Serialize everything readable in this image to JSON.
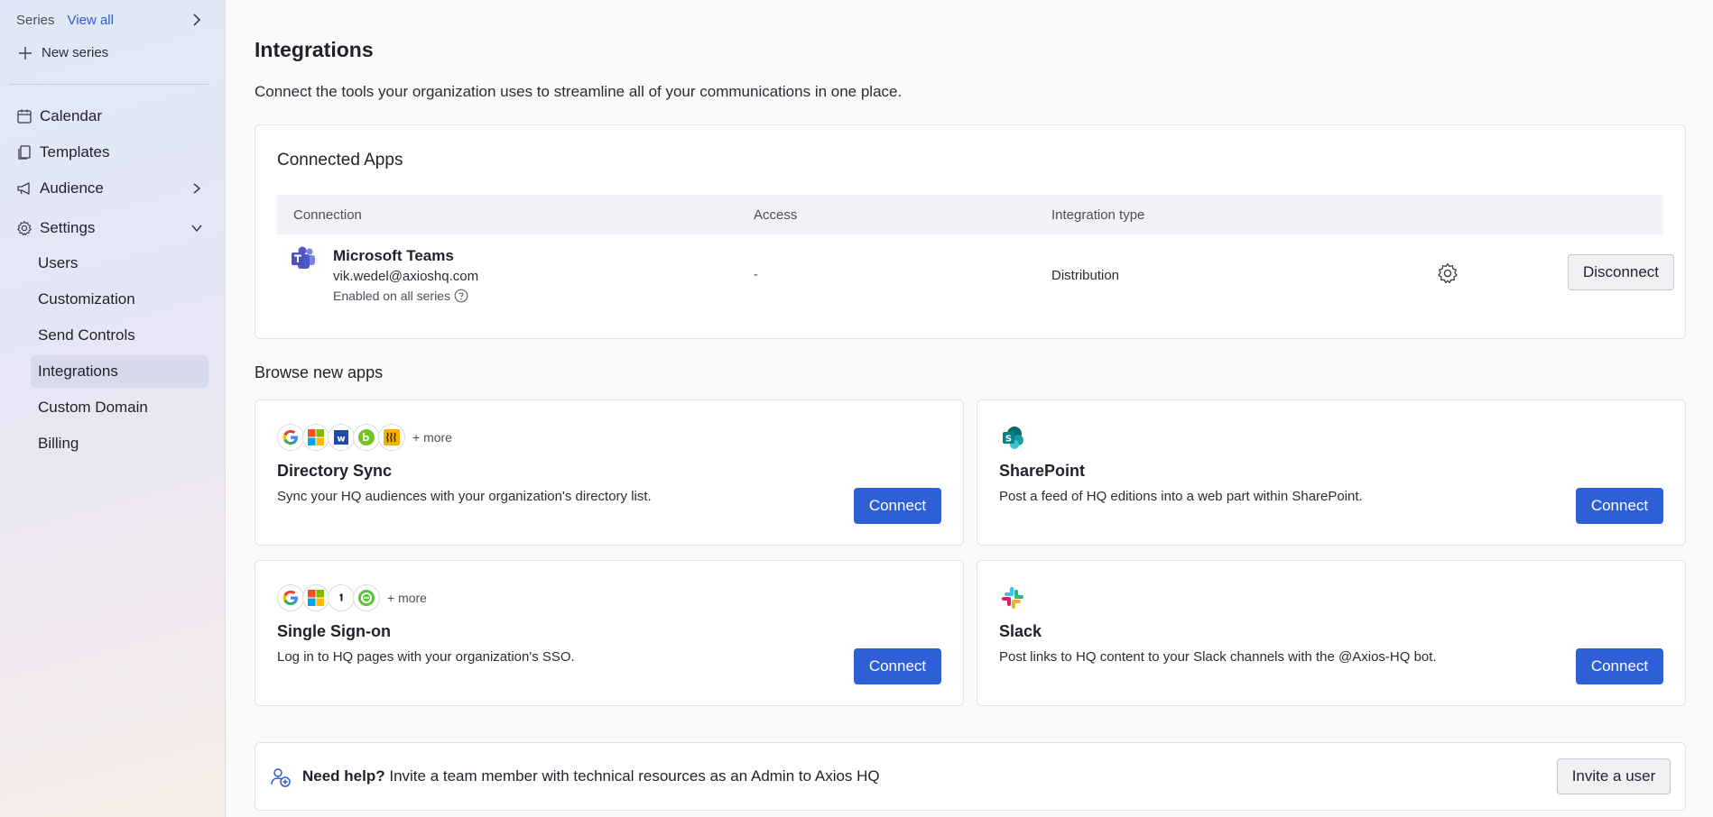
{
  "sidebar": {
    "series_label": "Series",
    "view_all": "View all",
    "new_series": "New series",
    "nav": {
      "calendar": "Calendar",
      "templates": "Templates",
      "audience": "Audience",
      "settings": "Settings"
    },
    "settings_items": {
      "users": "Users",
      "customization": "Customization",
      "send_controls": "Send Controls",
      "integrations": "Integrations",
      "custom_domain": "Custom Domain",
      "billing": "Billing"
    },
    "active_item": "Integrations"
  },
  "main": {
    "title": "Integrations",
    "subtitle": "Connect the tools your organization uses to streamline all of your communications in one place."
  },
  "connected_apps": {
    "title": "Connected Apps",
    "columns": {
      "connection": "Connection",
      "access": "Access",
      "integration_type": "Integration type"
    },
    "rows": [
      {
        "name": "Microsoft Teams",
        "email": "vik.wedel@axioshq.com",
        "enabled": "Enabled on all series",
        "access": "-",
        "type": "Distribution",
        "action": "Disconnect"
      }
    ]
  },
  "browse": {
    "title": "Browse new apps",
    "apps": [
      {
        "name": "Directory Sync",
        "desc": "Sync your HQ audiences with your organization's directory list.",
        "more": "+ more",
        "action": "Connect"
      },
      {
        "name": "SharePoint",
        "desc": "Post a feed of HQ editions into a web part within SharePoint.",
        "action": "Connect"
      },
      {
        "name": "Single Sign-on",
        "desc": "Log in to HQ pages with your organization's SSO.",
        "more": "+ more",
        "action": "Connect"
      },
      {
        "name": "Slack",
        "desc": "Post links to HQ content to your Slack channels with the @Axios-HQ bot.",
        "action": "Connect"
      }
    ]
  },
  "help": {
    "bold": "Need help?",
    "text": " Invite a team member with technical resources as an Admin to Axios HQ",
    "action": "Invite a user"
  },
  "colors": {
    "primary": "#2f5fd6",
    "link": "#2f5bd6",
    "active_nav": "#d6daea"
  }
}
